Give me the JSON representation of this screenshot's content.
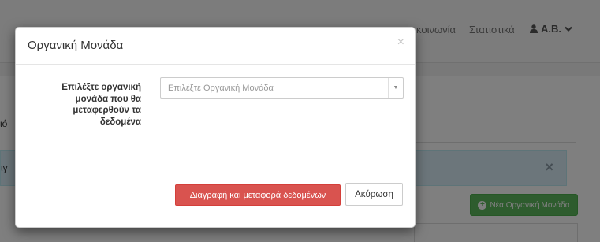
{
  "navbar": {
    "community_link": "κοινωνία",
    "statistics_link": "Στατιστικά",
    "user_label": "Α.Β.",
    "user_icon": "user-icon",
    "dropdown_icon": "chevron-down-icon"
  },
  "page": {
    "alert_close": "×",
    "edge_char_1": "ιό",
    "edge_char_2": "ιγ",
    "new_unit_button": "Νέα Οργανική Μονάδα",
    "new_unit_icon": "plus-circle-icon"
  },
  "modal": {
    "title": "Οργανική Μονάδα",
    "close_symbol": "×",
    "field_label": "Επιλέξτε οργανική μονάδα που θα μεταφερθούν τα δεδομένα",
    "select_placeholder": "Επιλέξτε Οργανική Μονάδα",
    "select_arrow": "▼",
    "delete_transfer_button": "Διαγραφή και μεταφορά δεδομένων",
    "cancel_button": "Ακύρωση"
  },
  "colors": {
    "danger": "#d9534f",
    "success": "#5cb85c",
    "info_bg": "#d9edf7"
  }
}
